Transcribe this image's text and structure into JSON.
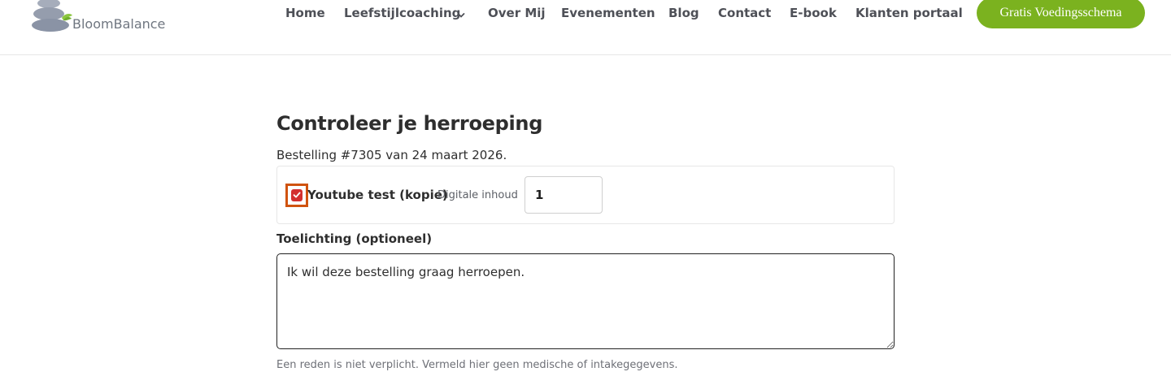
{
  "header": {
    "logo_text": "BloomBalance",
    "nav": [
      {
        "label": "Home"
      },
      {
        "label": "Leefstijlcoaching",
        "has_dropdown": true
      },
      {
        "label": "Over Mij"
      },
      {
        "label": "Evenementen"
      },
      {
        "label": "Blog"
      },
      {
        "label": "Contact"
      },
      {
        "label": "E-book"
      },
      {
        "label": "Klanten portaal"
      }
    ],
    "cta_label": "Gratis Voedingsschema"
  },
  "main": {
    "title": "Controleer je herroeping",
    "order_line": "Bestelling #7305 van 24 maart 2026.",
    "item": {
      "checked": true,
      "name": "Youtube test (kopie)",
      "type": "Digitale inhoud",
      "quantity": "1"
    },
    "explanation_label": "Toelichting (optioneel)",
    "explanation_value": "Ik wil deze bestelling graag herroepen.",
    "hint": "Een reden is niet verplicht. Vermeld hier geen medische of intakegegevens."
  },
  "colors": {
    "accent_green": "#7bb21f",
    "checkbox_red": "#d32f2f",
    "focus_orange": "#d0530f",
    "logo_stone": "#8e97a8"
  }
}
